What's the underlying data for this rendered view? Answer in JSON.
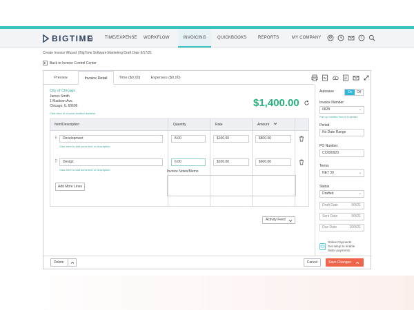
{
  "brand": {
    "name": "BIGTIME",
    "accent": "#3cc0bd"
  },
  "nav": {
    "items": [
      {
        "label": "TIME/EXPENSE"
      },
      {
        "label": "WORKFLOW"
      },
      {
        "label": "INVOICING"
      },
      {
        "label": "QUICKBOOKS"
      },
      {
        "label": "REPORTS"
      },
      {
        "label": "MY COMPANY"
      }
    ],
    "active": "INVOICING"
  },
  "breadcrumb": "Create Invoice Wizard | BigTime Software:Marketing Draft Date 6/17/21",
  "back_link": "Back to Invoice Control Center",
  "tabs": [
    "Preview",
    "Invoice Detail",
    "Time ($0.00)",
    "Expenses ($0.00)"
  ],
  "client": {
    "name": "City of Chicago",
    "contact": "James Smith",
    "street": "1 Madison Ave.",
    "city": "Chicago, IL 60606",
    "choose_link": "Click here to choose another address"
  },
  "invoice_total": "$1,400.00",
  "table": {
    "headers": [
      "Item/Description",
      "Quantity",
      "Rate",
      "Amount"
    ],
    "rows": [
      {
        "item": "Development",
        "quantity": "8.00",
        "rate": "$100.00",
        "amount": "$800.00",
        "desc_link": "Click here to add some text or description"
      },
      {
        "item": "Design",
        "quantity": "6.00",
        "rate": "$100.00",
        "amount": "$600.00",
        "desc_link": "Click here to add some text or description"
      }
    ],
    "add_more": "Add More Lines"
  },
  "notes_label": "Invoice Notes/Memo",
  "activity_feed": "Activity Feed",
  "sidebar": {
    "autosave_label": "Autosave",
    "toggle_on": "On",
    "toggle_off": "Off",
    "invoice_number_label": "Invoice Number",
    "invoice_number": "0828",
    "invoice_number_link": "Print up Unbilled Time & Expenses",
    "period_label": "Period",
    "period": "No Date Range",
    "po_label": "PO Number",
    "po": "CC090920",
    "terms_label": "Terms",
    "terms": "NET 30",
    "status_label": "Status",
    "status": "Drafted",
    "dates": [
      {
        "label": "Draft Date",
        "value": "9/9/21"
      },
      {
        "label": "Sent Date",
        "value": "9/9/21"
      },
      {
        "label": "Due Date",
        "value": "10/9/21"
      }
    ],
    "online_payments": [
      "Online Payments",
      "Get setup to enable",
      "faster payments."
    ]
  },
  "footer": {
    "delete": "Delete",
    "cancel": "Cancel",
    "save": "Save Changes"
  }
}
